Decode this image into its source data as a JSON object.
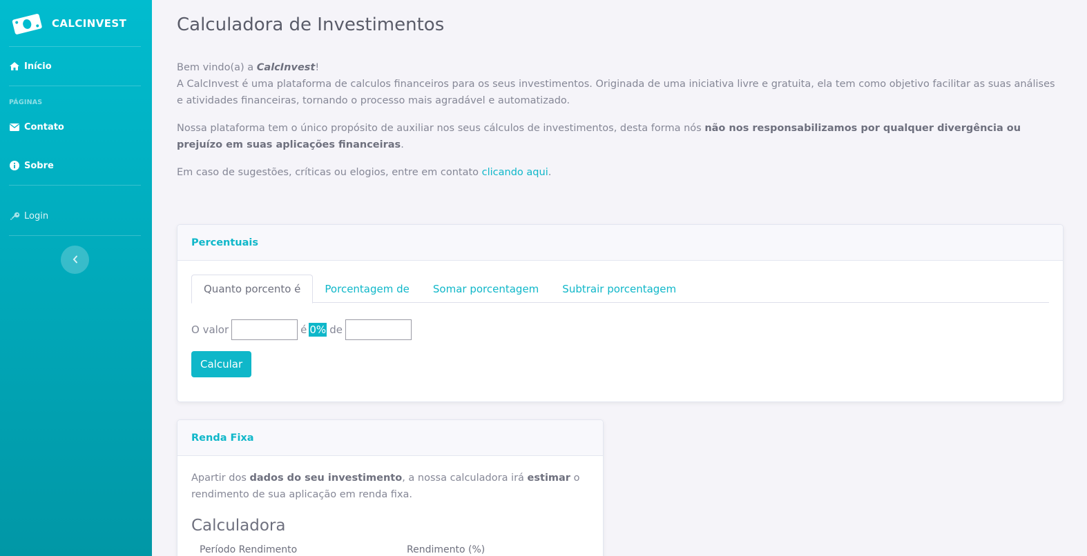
{
  "sidebar": {
    "brand": "CALCINVEST",
    "items": [
      {
        "label": "Início",
        "icon": "home-icon"
      },
      {
        "label": "Contato",
        "icon": "envelope-icon"
      },
      {
        "label": "Sobre",
        "icon": "info-icon"
      },
      {
        "label": "Login",
        "icon": "key-icon"
      }
    ],
    "heading": "PÁGINAS"
  },
  "page": {
    "title": "Calculadora de Investimentos",
    "intro": {
      "p1_a": "Bem vindo(a) a ",
      "p1_b": "CalcInvest",
      "p1_c": "!",
      "p1_d": "A CalcInvest é uma plataforma de calculos financeiros para os seus investimentos. Originada de uma iniciativa livre e gratuita, ela tem como objetivo facilitar as suas análises e atividades financeiras, tornando o processo mais agradável e automatizado.",
      "p2_a": "Nossa plataforma tem o único propósito de auxiliar nos seus cálculos de investimentos, desta forma nós ",
      "p2_b": "não nos responsabilizamos por qualquer divergência ou prejuízo em suas aplicações financeiras",
      "p2_c": ".",
      "p3_a": "Em caso de sugestões, críticas ou elogios, entre em contato ",
      "p3_link": "clicando aqui",
      "p3_c": "."
    }
  },
  "percentuais": {
    "header": "Percentuais",
    "tabs": [
      "Quanto porcento é",
      "Porcentagem de",
      "Somar porcentagem",
      "Subtrair porcentagem"
    ],
    "label_valor": "O valor",
    "label_e": "é",
    "result": "0%",
    "label_de": "de",
    "input1_value": "",
    "input2_value": "",
    "button": "Calcular"
  },
  "renda_fixa": {
    "header": "Renda Fixa",
    "text_a": "Apartir dos ",
    "text_b": "dados do seu investimento",
    "text_c": ", a nossa calculadora irá ",
    "text_d": "estimar",
    "text_e": " o rendimento de sua aplicação em renda fixa.",
    "subtitle": "Calculadora",
    "col1": "Período Rendimento",
    "col2": "Rendimento (%)"
  },
  "colors": {
    "accent": "#0fb7c9",
    "sidebar_top": "#01bccf",
    "sidebar_bottom": "#0197a6"
  }
}
